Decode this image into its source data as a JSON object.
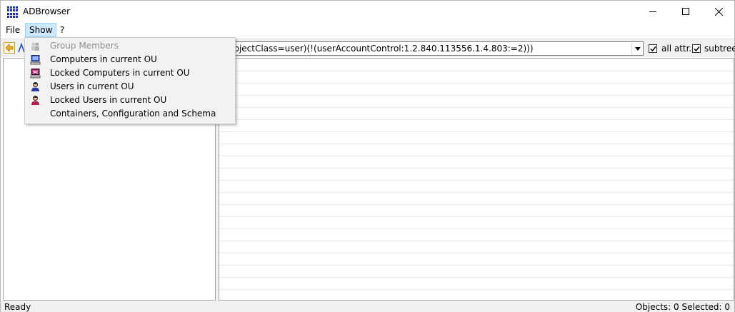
{
  "window": {
    "title": "ADBrowser",
    "colors": {
      "accent": "#1c2fa8",
      "menu_highlight": "#cce8ff",
      "toolbar_bg": "#f0f0f0"
    }
  },
  "menubar": {
    "file_label": "File",
    "show_label": "Show",
    "help_label": "?"
  },
  "toolbar": {
    "filter_value": "objectClass=user)(!(userAccountControl:1.2.840.113556.1.4.803:=2)))",
    "all_attr_label": "all attr.",
    "all_attr_checked": true,
    "subtree_label": "subtree",
    "subtree_checked": true
  },
  "show_menu": {
    "items": [
      {
        "label": "Group Members",
        "icon": "group-members-icon",
        "enabled": false
      },
      {
        "label": "Computers in current OU",
        "icon": "computer-icon",
        "enabled": true
      },
      {
        "label": "Locked Computers in current OU",
        "icon": "locked-computer-icon",
        "enabled": true
      },
      {
        "label": "Users in current OU",
        "icon": "user-icon",
        "enabled": true
      },
      {
        "label": "Locked Users in current OU",
        "icon": "locked-user-icon",
        "enabled": true
      },
      {
        "label": "Containers, Configuration and Schema",
        "icon": "",
        "enabled": true
      }
    ]
  },
  "statusbar": {
    "left": "Ready",
    "right": "Objects: 0 Selected: 0"
  }
}
